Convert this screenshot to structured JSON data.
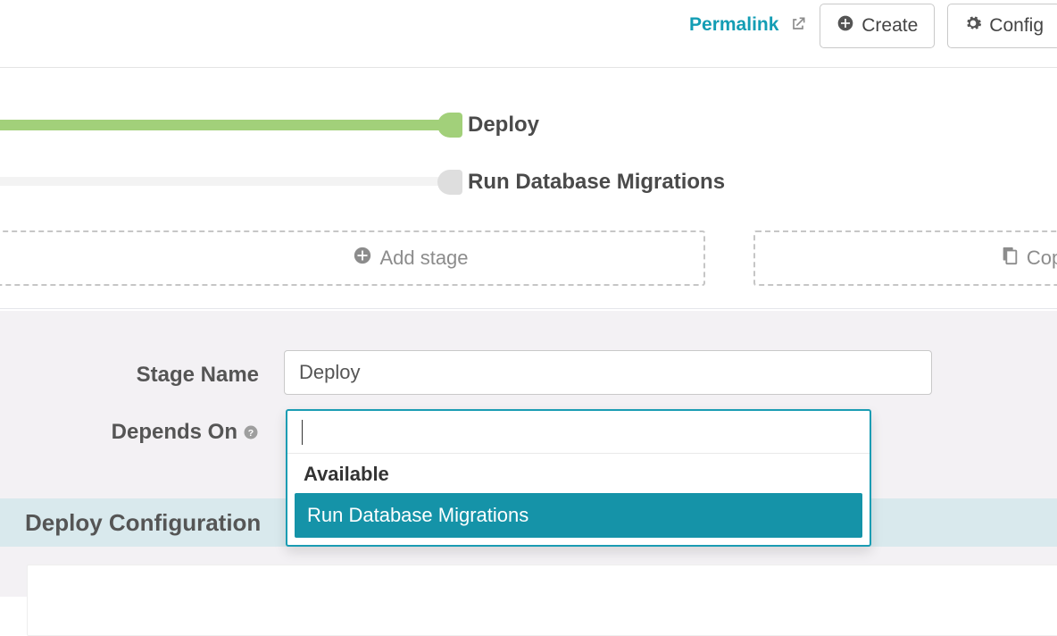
{
  "topbar": {
    "permalink_label": "Permalink",
    "create_label": "Create",
    "configure_label": "Config"
  },
  "pipeline": {
    "stages": [
      {
        "label": "Deploy",
        "status": "ok"
      },
      {
        "label": "Run Database Migrations",
        "status": "idle"
      }
    ],
    "add_stage_label": "Add stage",
    "copy_stage_label": "Copy an existi"
  },
  "form": {
    "stage_name_label": "Stage Name",
    "stage_name_value": "Deploy",
    "depends_on_label": "Depends On",
    "depends_on_value": "",
    "depends_on_group": "Available",
    "depends_on_options": [
      "Run Database Migrations"
    ]
  },
  "section": {
    "title": "Deploy Configuration"
  }
}
